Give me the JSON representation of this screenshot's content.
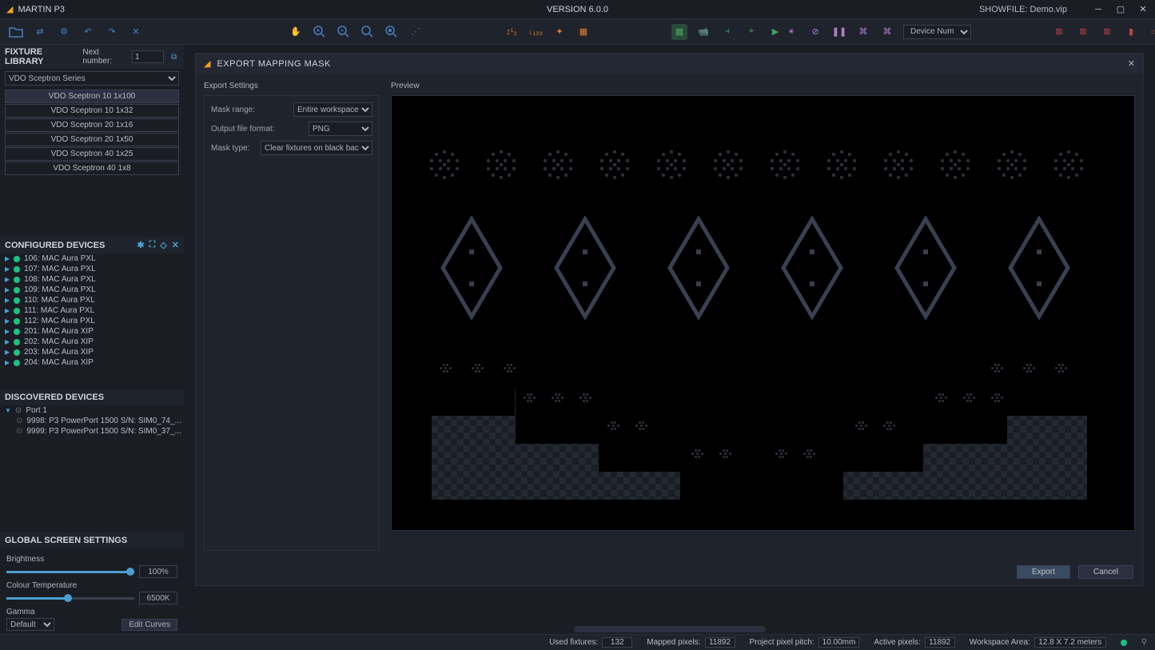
{
  "titlebar": {
    "app": "MARTIN P3",
    "version": "VERSION 6.0.0",
    "showfile_label": "SHOWFILE:",
    "showfile": "Demo.vip"
  },
  "toolbar": {
    "device_select": "Device Num"
  },
  "fixture_library": {
    "header": "FIXTURE LIBRARY",
    "next_label": "Next number:",
    "next_value": "1",
    "series": "VDO Sceptron Series",
    "items": [
      "VDO Sceptron 10 1x100",
      "VDO Sceptron 10 1x32",
      "VDO Sceptron 20 1x16",
      "VDO Sceptron 20 1x50",
      "VDO Sceptron 40 1x25",
      "VDO Sceptron 40 1x8"
    ]
  },
  "configured": {
    "header": "CONFIGURED DEVICES",
    "items": [
      "106: MAC Aura PXL",
      "107: MAC Aura PXL",
      "108: MAC Aura PXL",
      "109: MAC Aura PXL",
      "110: MAC Aura PXL",
      "111: MAC Aura PXL",
      "112: MAC Aura PXL",
      "201: MAC Aura XIP",
      "202: MAC Aura XIP",
      "203: MAC Aura XIP",
      "204: MAC Aura XIP"
    ]
  },
  "discovered": {
    "header": "DISCOVERED DEVICES",
    "port": "Port 1",
    "items": [
      "9998: P3 PowerPort 1500 S/N: SIM0_74_...",
      "9999: P3 PowerPort 1500 S/N: SIM0_37_..."
    ]
  },
  "screen": {
    "header": "GLOBAL SCREEN SETTINGS",
    "brightness_label": "Brightness",
    "brightness_value": "100%",
    "ct_label": "Colour Temperature",
    "ct_value": "6500K",
    "gamma_label": "Gamma",
    "gamma_value": "Default",
    "edit_curves": "Edit Curves"
  },
  "dialog": {
    "title": "EXPORT MAPPING MASK",
    "export_settings": "Export Settings",
    "preview": "Preview",
    "mask_range_label": "Mask range:",
    "mask_range_value": "Entire workspace",
    "output_fmt_label": "Output file format:",
    "output_fmt_value": "PNG",
    "mask_type_label": "Mask type:",
    "mask_type_value": "Clear fixtures on black background",
    "export_btn": "Export",
    "cancel_btn": "Cancel"
  },
  "status": {
    "used_fixtures_label": "Used fixtures:",
    "used_fixtures": "132",
    "mapped_label": "Mapped pixels:",
    "mapped": "11892",
    "pitch_label": "Project pixel pitch:",
    "pitch": "10.00mm",
    "active_label": "Active pixels:",
    "active": "11892",
    "area_label": "Workspace Area:",
    "area": "12.8 X 7.2 meters"
  }
}
